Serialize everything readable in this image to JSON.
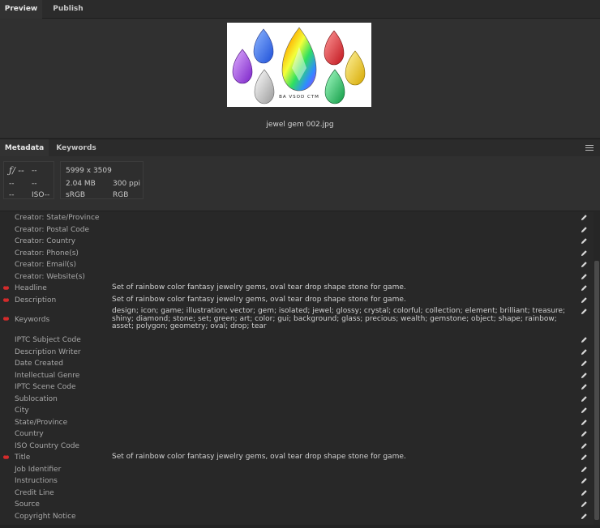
{
  "tabs": {
    "preview": "Preview",
    "publish": "Publish"
  },
  "preview": {
    "filename": "jewel gem 002.jpg",
    "watermark": "BA  VSOD  CTM"
  },
  "meta_tabs": {
    "metadata": "Metadata",
    "keywords": "Keywords"
  },
  "camera": {
    "f": "ƒ/ --",
    "exposure": "--",
    "r2a": "--",
    "r2b": "--",
    "r3a": "--",
    "iso": "ISO--"
  },
  "fileinfo": {
    "dims": "5999 x 3509",
    "size": "2.04 MB",
    "ppi": "300 ppi",
    "profile": "sRGB",
    "mode": "RGB"
  },
  "fields": [
    {
      "label": "Creator: State/Province",
      "value": "",
      "required": false
    },
    {
      "label": "Creator: Postal Code",
      "value": "",
      "required": false
    },
    {
      "label": "Creator: Country",
      "value": "",
      "required": false
    },
    {
      "label": "Creator: Phone(s)",
      "value": "",
      "required": false
    },
    {
      "label": "Creator: Email(s)",
      "value": "",
      "required": false
    },
    {
      "label": "Creator: Website(s)",
      "value": "",
      "required": false
    },
    {
      "label": "Headline",
      "value": "Set of rainbow color fantasy jewelry gems, oval tear drop shape stone for game.",
      "required": true
    },
    {
      "label": "Description",
      "value": "Set of rainbow color fantasy jewelry gems, oval tear drop shape stone for game.",
      "required": true
    },
    {
      "label": "Keywords",
      "value": "design; icon; game; illustration; vector; gem; isolated; jewel; glossy; crystal; colorful; collection; element; brilliant; treasure; shiny; diamond; stone; set; green; art; color; gui; background; glass; precious; wealth; gemstone; object; shape; rainbow; asset; polygon; geometry; oval; drop; tear",
      "required": true
    },
    {
      "label": "IPTC Subject Code",
      "value": "",
      "required": false
    },
    {
      "label": "Description Writer",
      "value": "",
      "required": false
    },
    {
      "label": "Date Created",
      "value": "",
      "required": false
    },
    {
      "label": "Intellectual Genre",
      "value": "",
      "required": false
    },
    {
      "label": "IPTC Scene Code",
      "value": "",
      "required": false
    },
    {
      "label": "Sublocation",
      "value": "",
      "required": false
    },
    {
      "label": "City",
      "value": "",
      "required": false
    },
    {
      "label": "State/Province",
      "value": "",
      "required": false
    },
    {
      "label": "Country",
      "value": "",
      "required": false
    },
    {
      "label": "ISO Country Code",
      "value": "",
      "required": false
    },
    {
      "label": "Title",
      "value": "Set of rainbow color fantasy jewelry gems, oval tear drop shape stone for game.",
      "required": true
    },
    {
      "label": "Job Identifier",
      "value": "",
      "required": false
    },
    {
      "label": "Instructions",
      "value": "",
      "required": false
    },
    {
      "label": "Credit Line",
      "value": "",
      "required": false
    },
    {
      "label": "Source",
      "value": "",
      "required": false
    },
    {
      "label": "Copyright Notice",
      "value": "",
      "required": false
    }
  ],
  "colors": {
    "required_marker": "#d42b2b",
    "pencil": "#d8d8d8"
  },
  "icons": {
    "edit": "pencil-icon",
    "required": "required-marker-icon",
    "panel_menu": "panel-menu-icon"
  }
}
